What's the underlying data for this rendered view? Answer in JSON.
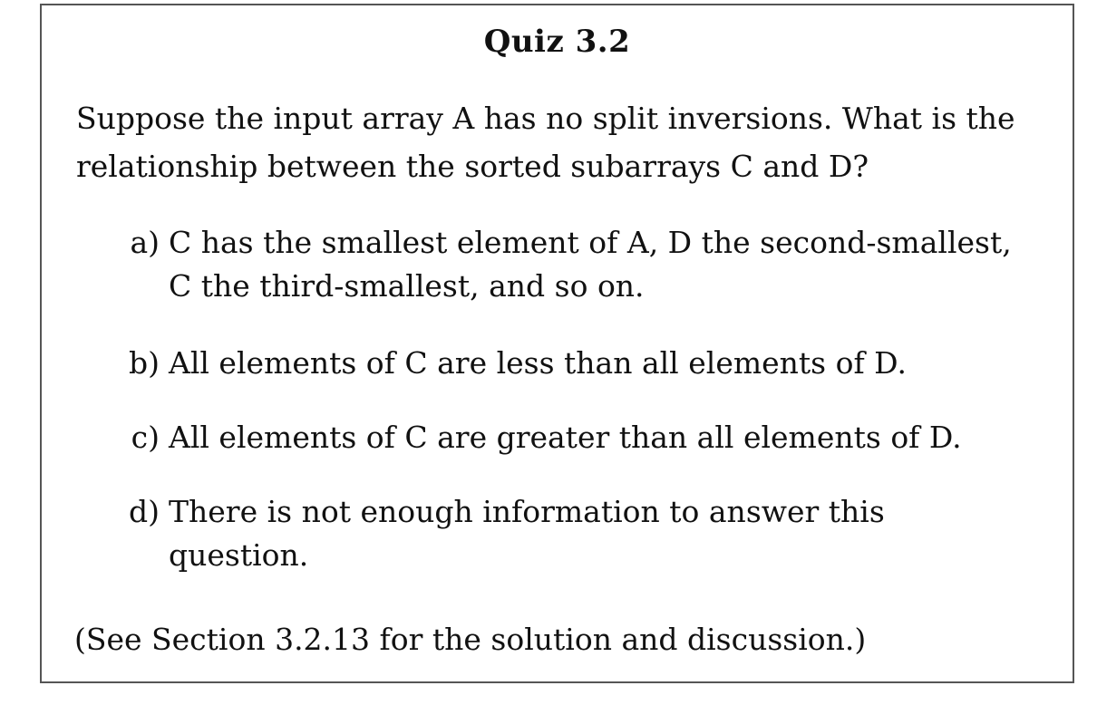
{
  "quiz": {
    "title": "Quiz 3.2",
    "question": "Suppose the input array A has no split inversions. What is the relationship between the sorted subarrays C and D?",
    "options": [
      {
        "letter": "a)",
        "text": "C has the smallest element of A, D the second-smallest, C the third-smallest, and so on."
      },
      {
        "letter": "b)",
        "text": "All elements of C are less than all elements of D."
      },
      {
        "letter": "c)",
        "text": "All elements of C are greater than all elements of D."
      },
      {
        "letter": "d)",
        "text": "There is not enough information to answer this question."
      }
    ],
    "footnote": "(See Section 3.2.13 for the solution and discussion.)"
  }
}
